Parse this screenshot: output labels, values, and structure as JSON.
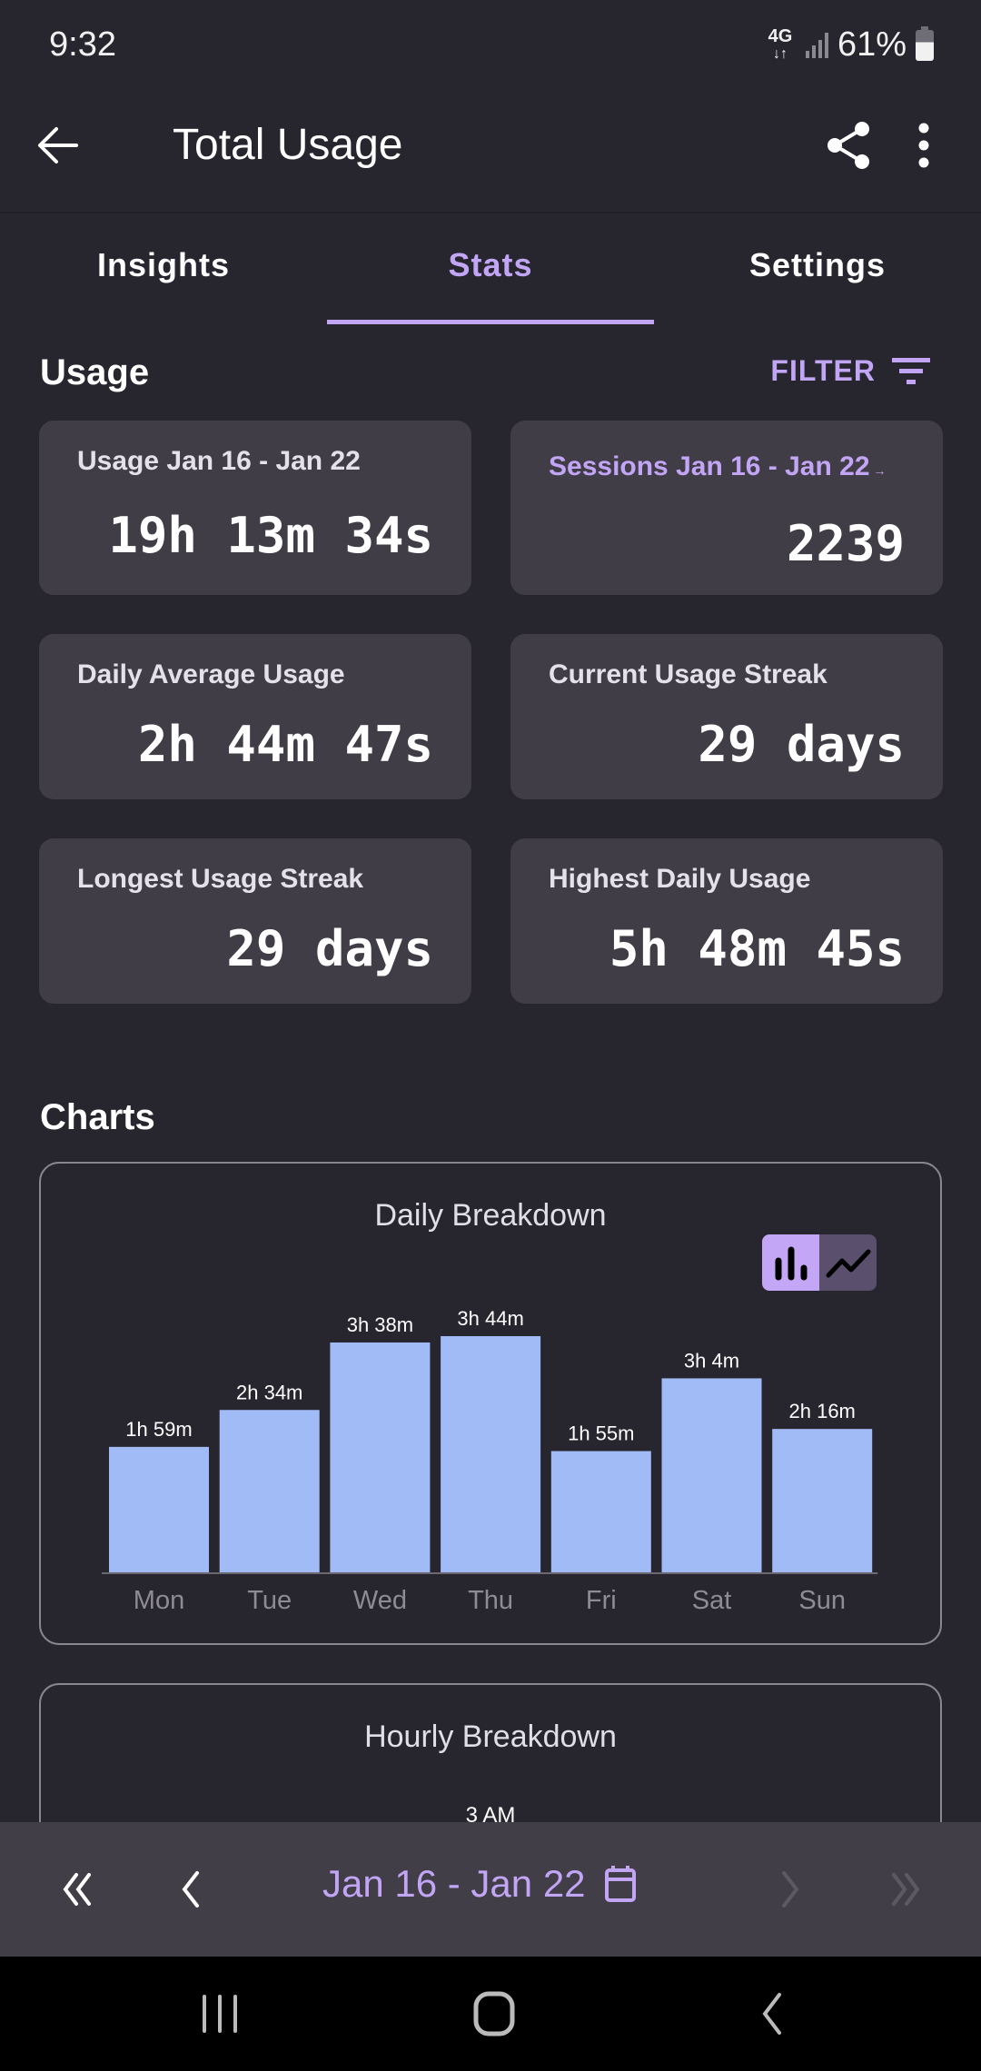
{
  "status_bar": {
    "time": "9:32",
    "network": "4G LTE",
    "battery": "61%"
  },
  "app_bar": {
    "title": "Total Usage",
    "back_icon": "arrow-left-icon",
    "share_icon": "share-icon",
    "more_icon": "more-vert-icon"
  },
  "tabs": [
    {
      "label": "Insights",
      "active": false
    },
    {
      "label": "Stats",
      "active": true
    },
    {
      "label": "Settings",
      "active": false
    }
  ],
  "usage_section": {
    "title": "Usage",
    "filter_label": "FILTER",
    "filter_icon": "filter-list-icon"
  },
  "stat_cards": [
    {
      "label": "Usage Jan 16 - Jan 22",
      "value": "19h 13m 34s",
      "accent": false
    },
    {
      "label": "Sessions Jan 16 - Jan 22",
      "value": "2239",
      "accent": true
    },
    {
      "label": "Daily Average Usage",
      "value": "2h 44m 47s",
      "accent": false
    },
    {
      "label": "Current Usage Streak",
      "value": "29 days",
      "accent": false
    },
    {
      "label": "Longest Usage Streak",
      "value": "29 days",
      "accent": false
    },
    {
      "label": "Highest Daily Usage",
      "value": "5h 48m 45s",
      "accent": false
    }
  ],
  "charts_section": {
    "title": "Charts"
  },
  "chart_data": [
    {
      "type": "bar",
      "title": "Daily Breakdown",
      "categories": [
        "Mon",
        "Tue",
        "Wed",
        "Thu",
        "Fri",
        "Sat",
        "Sun"
      ],
      "values": [
        119,
        154,
        218,
        224,
        115,
        184,
        136
      ],
      "value_labels": [
        "1h 59m",
        "2h 34m",
        "3h 38m",
        "3h 44m",
        "1h 55m",
        "3h 4m",
        "2h 16m"
      ],
      "unit": "minutes",
      "xlabel": "",
      "ylabel": "",
      "ylim": [
        0,
        224
      ],
      "grid": false,
      "bar_color": "#a1bbf7",
      "view_mode": "bar",
      "view_modes": [
        "bar",
        "line"
      ]
    },
    {
      "type": "bar",
      "title": "Hourly Breakdown",
      "visible_labels": [
        "3 AM"
      ]
    }
  ],
  "bottom_nav": {
    "date_range": "Jan 16 - Jan 22",
    "first_enabled": true,
    "prev_enabled": true,
    "next_enabled": false,
    "last_enabled": false
  },
  "colors": {
    "accent": "#c2a5f5",
    "background": "#27252e",
    "card": "#403d47",
    "bar": "#a1bbf7"
  }
}
